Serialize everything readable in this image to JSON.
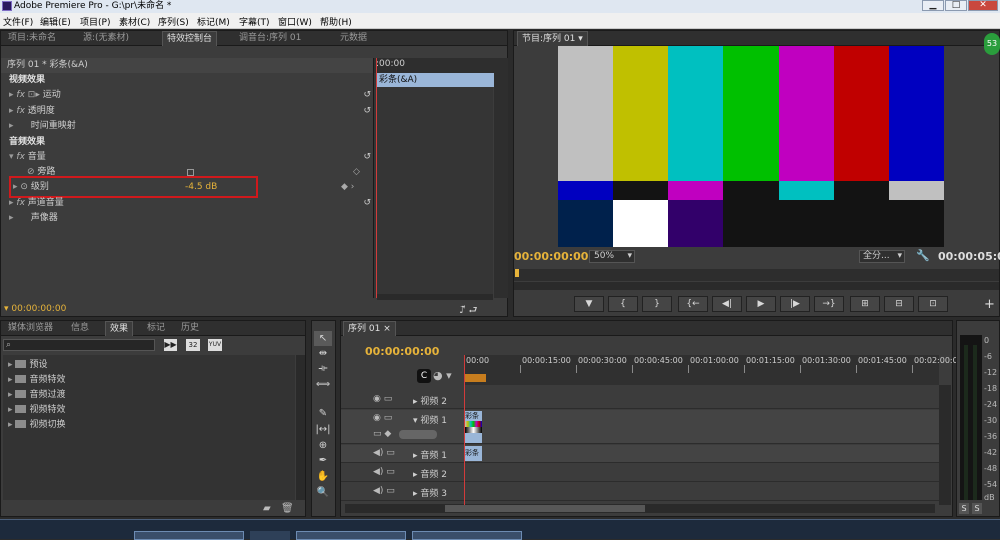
{
  "app": {
    "title": "Adobe Premiere Pro - G:\\pr\\未命名 *",
    "win_min": "▁",
    "win_max": "□",
    "win_close": "✕"
  },
  "menu": [
    "文件(F)",
    "编辑(E)",
    "项目(P)",
    "素材(C)",
    "序列(S)",
    "标记(M)",
    "字幕(T)",
    "窗口(W)",
    "帮助(H)"
  ],
  "left_tabs": [
    "项目:未命名",
    "源:(无素材)",
    "特效控制台",
    "调音台:序列 01",
    "元数据"
  ],
  "effect_controls": {
    "header": "序列 01 * 彩条(&A)",
    "timeline_time": ":00:00",
    "clip_label": "彩条(&A)",
    "video_section": "视频效果",
    "video_items": [
      "运动",
      "透明度",
      "时间重映射"
    ],
    "audio_section": "音频效果",
    "audio_items": [
      "音量",
      "旁路",
      "级别",
      "声道音量",
      "声像器"
    ],
    "level_value": "-4.5 dB",
    "current_time": "00:00:00:00",
    "colors": {
      "timecode": "#e6b33a",
      "highlight_box": "#d0191c",
      "clip": "#9ab6d8"
    }
  },
  "program": {
    "tab": "节目:序列 01",
    "timecode": "00:00:00:00",
    "zoom": "50%",
    "fit": "全分...",
    "duration": "00:00:05:00",
    "bars_top": [
      "#c0c0c0",
      "#c0c000",
      "#00c0c0",
      "#00c000",
      "#c000c0",
      "#c00000",
      "#0000c0"
    ],
    "bars_mid": [
      "#0000c0",
      "#131313",
      "#c000c0",
      "#131313",
      "#00c0c0",
      "#131313",
      "#c0c0c0"
    ],
    "bars_bottom": [
      "#00214c",
      "#ffffff",
      "#32006a",
      "#131313",
      "#131313",
      "#131313",
      "#131313"
    ],
    "controls": [
      "▼",
      "{",
      "}",
      "{←",
      "◀|",
      "▶",
      "|▶",
      "→}",
      "⊞",
      "⊟",
      "⊡"
    ]
  },
  "project_panel": {
    "tabs": [
      "媒体浏览器",
      "信息",
      "效果",
      "标记",
      "历史"
    ],
    "search_placeholder": "",
    "badges": [
      "32",
      "YUV"
    ],
    "items": [
      "预设",
      "音频特效",
      "音频过渡",
      "视频特效",
      "视频切换"
    ]
  },
  "tools": [
    "↖",
    "⇹",
    "⟛",
    "⟺",
    "✎",
    "|↔|",
    "⊕",
    "✒",
    "✋",
    "🔍"
  ],
  "sequence": {
    "tab": "序列 01",
    "timecode": "00:00:00:00",
    "ruler": [
      "00:00",
      "00:00:15:00",
      "00:00:30:00",
      "00:00:45:00",
      "00:01:00:00",
      "00:01:15:00",
      "00:01:30:00",
      "00:01:45:00",
      "00:02:00:00"
    ],
    "tracks": [
      "视频 2",
      "视频 1",
      "音频 1",
      "音频 2",
      "音频 3"
    ],
    "clip_video": "彩条",
    "clip_audio": "彩条"
  },
  "meter": {
    "scale": [
      "0",
      "-6",
      "-12",
      "-18",
      "-24",
      "-30",
      "-36",
      "-42",
      "-48",
      "-54",
      "dB"
    ],
    "solo": [
      "S",
      "S"
    ]
  }
}
